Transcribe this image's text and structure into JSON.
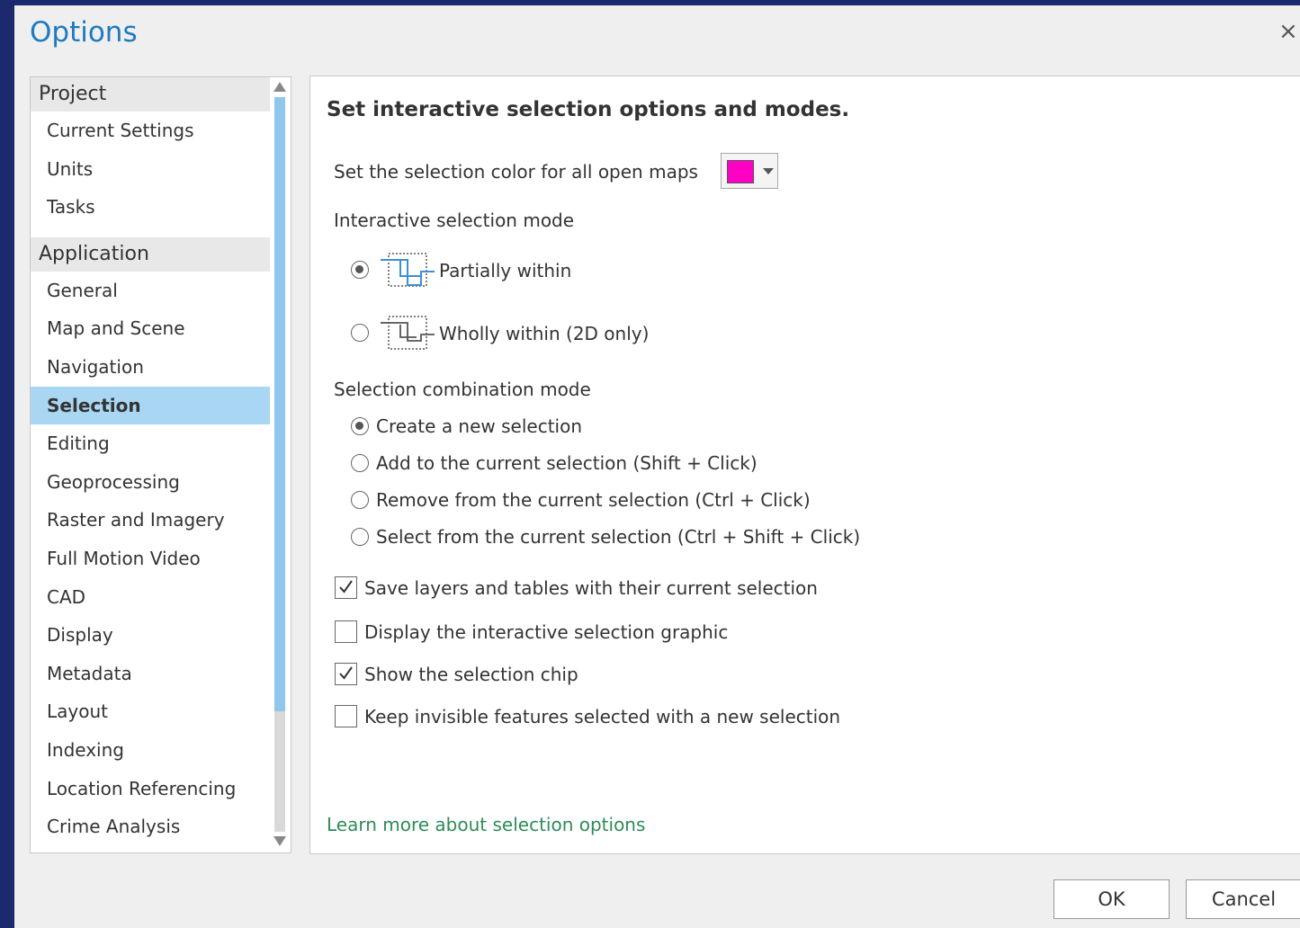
{
  "window": {
    "title": "Options",
    "close_glyph": "×"
  },
  "nav": {
    "groups": [
      {
        "label": "Project",
        "items": [
          "Current Settings",
          "Units",
          "Tasks"
        ]
      },
      {
        "label": "Application",
        "items": [
          "General",
          "Map and Scene",
          "Navigation",
          "Selection",
          "Editing",
          "Geoprocessing",
          "Raster and Imagery",
          "Full Motion Video",
          "CAD",
          "Display",
          "Metadata",
          "Layout",
          "Indexing",
          "Location Referencing",
          "Crime Analysis"
        ]
      }
    ],
    "selected": "Selection"
  },
  "panel": {
    "heading": "Set interactive selection options and modes.",
    "color_label": "Set the selection color for all open maps",
    "selection_color": "#ff00c5",
    "interactive_mode_label": "Interactive selection mode",
    "interactive_modes": [
      {
        "label": "Partially within",
        "checked": true,
        "icon": "partially-within-icon"
      },
      {
        "label": "Wholly within (2D only)",
        "checked": false,
        "icon": "wholly-within-icon"
      }
    ],
    "combination_label": "Selection combination mode",
    "combination_modes": [
      {
        "label": "Create a new selection",
        "checked": true
      },
      {
        "label": "Add to the current selection (Shift + Click)",
        "checked": false
      },
      {
        "label": "Remove from the current selection (Ctrl + Click)",
        "checked": false
      },
      {
        "label": "Select from the current selection (Ctrl + Shift + Click)",
        "checked": false
      }
    ],
    "checkboxes": [
      {
        "label": "Save layers and tables with their current selection",
        "checked": true
      },
      {
        "label": "Display the interactive selection graphic",
        "checked": false
      },
      {
        "label": "Show the selection chip",
        "checked": true
      },
      {
        "label": "Keep invisible features selected with a new selection",
        "checked": false
      }
    ],
    "learn_more": "Learn more about selection options"
  },
  "footer": {
    "ok": "OK",
    "cancel": "Cancel"
  },
  "colors": {
    "title": "#1f7abf",
    "nav_selected": "#a9d6f2",
    "link": "#2e8b57",
    "background": "#1a2a6c"
  }
}
